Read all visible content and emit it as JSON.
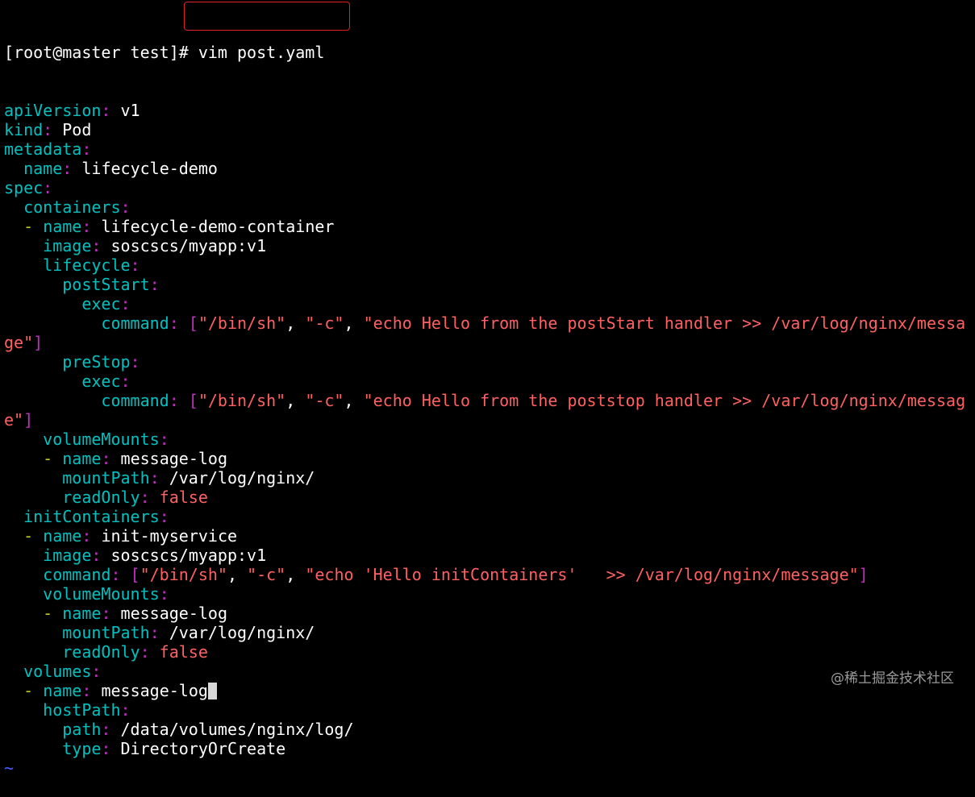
{
  "prompt": "[root@master test]# ",
  "command": "vim post.yaml",
  "lines": [
    [
      [
        "k",
        "apiVersion"
      ],
      [
        "c",
        ": "
      ],
      [
        "t",
        "v1"
      ]
    ],
    [
      [
        "k",
        "kind"
      ],
      [
        "c",
        ": "
      ],
      [
        "t",
        "Pod"
      ]
    ],
    [
      [
        "k",
        "metadata"
      ],
      [
        "c",
        ":"
      ]
    ],
    [
      [
        "t",
        "  "
      ],
      [
        "k",
        "name"
      ],
      [
        "c",
        ": "
      ],
      [
        "t",
        "lifecycle-demo"
      ]
    ],
    [
      [
        "k",
        "spec"
      ],
      [
        "c",
        ":"
      ]
    ],
    [
      [
        "t",
        "  "
      ],
      [
        "k",
        "containers"
      ],
      [
        "c",
        ":"
      ]
    ],
    [
      [
        "t",
        "  "
      ],
      [
        "d",
        "- "
      ],
      [
        "k",
        "name"
      ],
      [
        "c",
        ": "
      ],
      [
        "t",
        "lifecycle-demo-container"
      ]
    ],
    [
      [
        "t",
        "    "
      ],
      [
        "k",
        "image"
      ],
      [
        "c",
        ": "
      ],
      [
        "t",
        "soscscs/myapp:v1"
      ]
    ],
    [
      [
        "t",
        "    "
      ],
      [
        "k",
        "lifecycle"
      ],
      [
        "c",
        ":"
      ]
    ],
    [
      [
        "t",
        "      "
      ],
      [
        "k",
        "postStart"
      ],
      [
        "c",
        ":"
      ]
    ],
    [
      [
        "t",
        "        "
      ],
      [
        "k",
        "exec"
      ],
      [
        "c",
        ":"
      ]
    ],
    [
      [
        "t",
        "          "
      ],
      [
        "k",
        "command"
      ],
      [
        "c",
        ": ["
      ],
      [
        "s",
        "\"/bin/sh\""
      ],
      [
        "t",
        ", "
      ],
      [
        "s",
        "\"-c\""
      ],
      [
        "t",
        ", "
      ],
      [
        "s",
        "\"echo Hello from the postStart handler >> /var/log/nginx/messa"
      ]
    ],
    [
      [
        "s",
        "ge\""
      ],
      [
        "c",
        "]"
      ]
    ],
    [
      [
        "t",
        "      "
      ],
      [
        "k",
        "preStop"
      ],
      [
        "c",
        ":"
      ]
    ],
    [
      [
        "t",
        "        "
      ],
      [
        "k",
        "exec"
      ],
      [
        "c",
        ":"
      ]
    ],
    [
      [
        "t",
        "          "
      ],
      [
        "k",
        "command"
      ],
      [
        "c",
        ": ["
      ],
      [
        "s",
        "\"/bin/sh\""
      ],
      [
        "t",
        ", "
      ],
      [
        "s",
        "\"-c\""
      ],
      [
        "t",
        ", "
      ],
      [
        "s",
        "\"echo Hello from the poststop handler >> /var/log/nginx/messag"
      ]
    ],
    [
      [
        "s",
        "e\""
      ],
      [
        "c",
        "]"
      ]
    ],
    [
      [
        "t",
        "    "
      ],
      [
        "k",
        "volumeMounts"
      ],
      [
        "c",
        ":"
      ]
    ],
    [
      [
        "t",
        "    "
      ],
      [
        "d",
        "- "
      ],
      [
        "k",
        "name"
      ],
      [
        "c",
        ": "
      ],
      [
        "t",
        "message-log"
      ]
    ],
    [
      [
        "t",
        "      "
      ],
      [
        "k",
        "mountPath"
      ],
      [
        "c",
        ": "
      ],
      [
        "t",
        "/var/log/nginx/"
      ]
    ],
    [
      [
        "t",
        "      "
      ],
      [
        "k",
        "readOnly"
      ],
      [
        "c",
        ": "
      ],
      [
        "b",
        "false"
      ]
    ],
    [
      [
        "t",
        "  "
      ],
      [
        "k",
        "initContainers"
      ],
      [
        "c",
        ":"
      ]
    ],
    [
      [
        "t",
        "  "
      ],
      [
        "d",
        "- "
      ],
      [
        "k",
        "name"
      ],
      [
        "c",
        ": "
      ],
      [
        "t",
        "init-myservice"
      ]
    ],
    [
      [
        "t",
        "    "
      ],
      [
        "k",
        "image"
      ],
      [
        "c",
        ": "
      ],
      [
        "t",
        "soscscs/myapp:v1"
      ]
    ],
    [
      [
        "t",
        "    "
      ],
      [
        "k",
        "command"
      ],
      [
        "c",
        ": ["
      ],
      [
        "s",
        "\"/bin/sh\""
      ],
      [
        "t",
        ", "
      ],
      [
        "s",
        "\"-c\""
      ],
      [
        "t",
        ", "
      ],
      [
        "s",
        "\"echo 'Hello initContainers'   >> /var/log/nginx/message\""
      ],
      [
        "c",
        "]"
      ]
    ],
    [
      [
        "t",
        "    "
      ],
      [
        "k",
        "volumeMounts"
      ],
      [
        "c",
        ":"
      ]
    ],
    [
      [
        "t",
        "    "
      ],
      [
        "d",
        "- "
      ],
      [
        "k",
        "name"
      ],
      [
        "c",
        ": "
      ],
      [
        "t",
        "message-log"
      ]
    ],
    [
      [
        "t",
        "      "
      ],
      [
        "k",
        "mountPath"
      ],
      [
        "c",
        ": "
      ],
      [
        "t",
        "/var/log/nginx/"
      ]
    ],
    [
      [
        "t",
        "      "
      ],
      [
        "k",
        "readOnly"
      ],
      [
        "c",
        ": "
      ],
      [
        "b",
        "false"
      ]
    ],
    [
      [
        "t",
        "  "
      ],
      [
        "k",
        "volumes"
      ],
      [
        "c",
        ":"
      ]
    ],
    [
      [
        "t",
        "  "
      ],
      [
        "d",
        "- "
      ],
      [
        "k",
        "name"
      ],
      [
        "c",
        ": "
      ],
      [
        "t",
        "message-log"
      ],
      [
        "cursor",
        ""
      ]
    ],
    [
      [
        "t",
        "    "
      ],
      [
        "k",
        "hostPath"
      ],
      [
        "c",
        ":"
      ]
    ],
    [
      [
        "t",
        "      "
      ],
      [
        "k",
        "path"
      ],
      [
        "c",
        ": "
      ],
      [
        "t",
        "/data/volumes/nginx/log/"
      ]
    ],
    [
      [
        "t",
        "      "
      ],
      [
        "k",
        "type"
      ],
      [
        "c",
        ": "
      ],
      [
        "t",
        "DirectoryOrCreate"
      ]
    ],
    [
      [
        "tilde",
        "~"
      ]
    ]
  ],
  "watermark": "@稀土掘金技术社区"
}
